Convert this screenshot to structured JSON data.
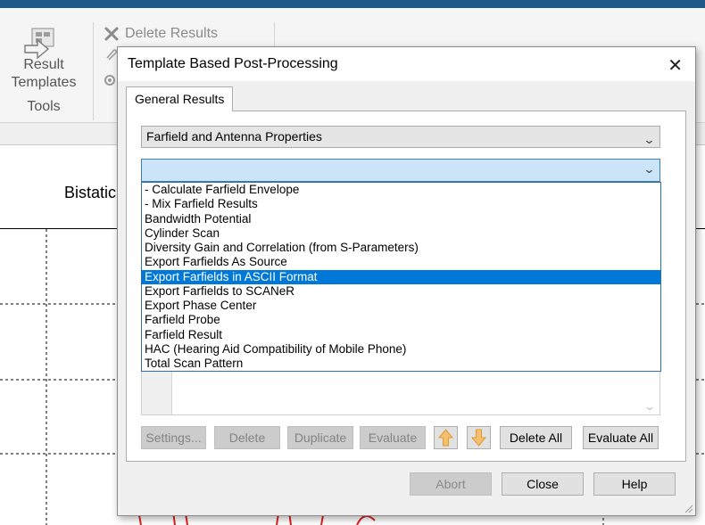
{
  "ribbon": {
    "result_templates_line1": "Result",
    "result_templates_line2": "Templates",
    "tools_label": "Tools",
    "delete_results": "Delete Results"
  },
  "plot": {
    "title_partial": "Bistatic"
  },
  "dialog": {
    "title": "Template Based Post-Processing",
    "tab": "General Results",
    "category_value": "Farfield and Antenna Properties",
    "template_value": "",
    "options": [
      "- Calculate Farfield Envelope",
      "- Mix Farfield Results",
      "Bandwidth Potential",
      "Cylinder Scan",
      "Diversity Gain and Correlation (from S-Parameters)",
      "Export Farfields As Source",
      "Export Farfields in ASCII Format",
      "Export Farfields to SCANeR",
      "Export Phase Center",
      "Farfield Probe",
      "Farfield Result",
      "HAC (Hearing Aid Compatibility of Mobile Phone)",
      "Total Scan Pattern"
    ],
    "selected_index": 6,
    "buttons": {
      "settings": "Settings...",
      "delete": "Delete",
      "duplicate": "Duplicate",
      "evaluate": "Evaluate",
      "delete_all": "Delete All",
      "evaluate_all": "Evaluate All",
      "abort": "Abort",
      "close": "Close",
      "help": "Help"
    }
  },
  "colors": {
    "selection": "#0078d7",
    "arrow_icon": "#f0a830",
    "plot_curve": "#e02020"
  }
}
